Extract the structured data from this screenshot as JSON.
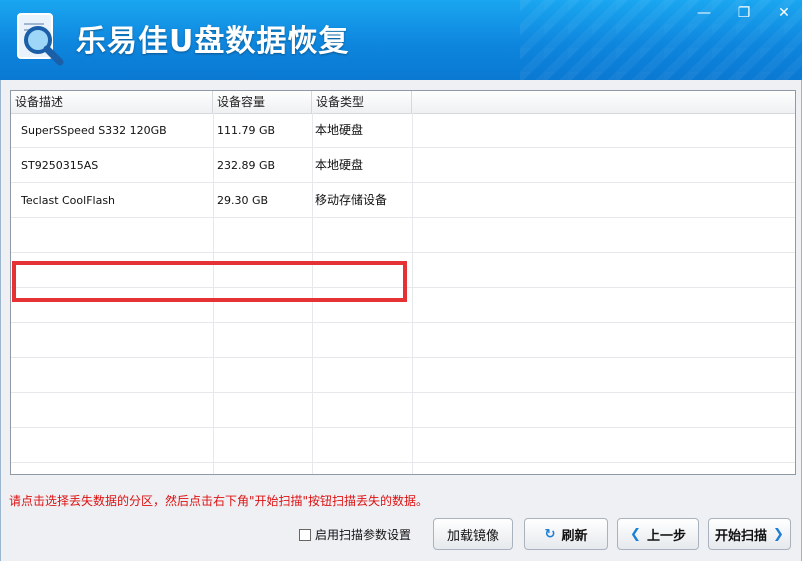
{
  "window": {
    "title": "乐易佳U盘数据恢复",
    "minimize": "—",
    "restore": "❐",
    "close": "✕"
  },
  "table": {
    "columns": [
      "设备描述",
      "设备容量",
      "设备类型"
    ],
    "rows": [
      {
        "desc": "SuperSSpeed S332 120GB",
        "size": "111.79 GB",
        "type": "本地硬盘"
      },
      {
        "desc": "ST9250315AS",
        "size": "232.89 GB",
        "type": "本地硬盘"
      },
      {
        "desc": "Teclast CoolFlash",
        "size": "29.30 GB",
        "type": "移动存储设备"
      }
    ]
  },
  "hint": "请点击选择丢失数据的分区，然后点击右下角\"开始扫描\"按钮扫描丢失的数据。",
  "options": {
    "scan_params_label": "启用扫描参数设置"
  },
  "buttons": {
    "load_image": "加载镜像",
    "refresh": "刷新",
    "prev": "上一步",
    "start_scan": "开始扫描"
  },
  "colors": {
    "titlebar": "#0e86de",
    "highlight": "#e53235",
    "hint": "#dd1111"
  }
}
